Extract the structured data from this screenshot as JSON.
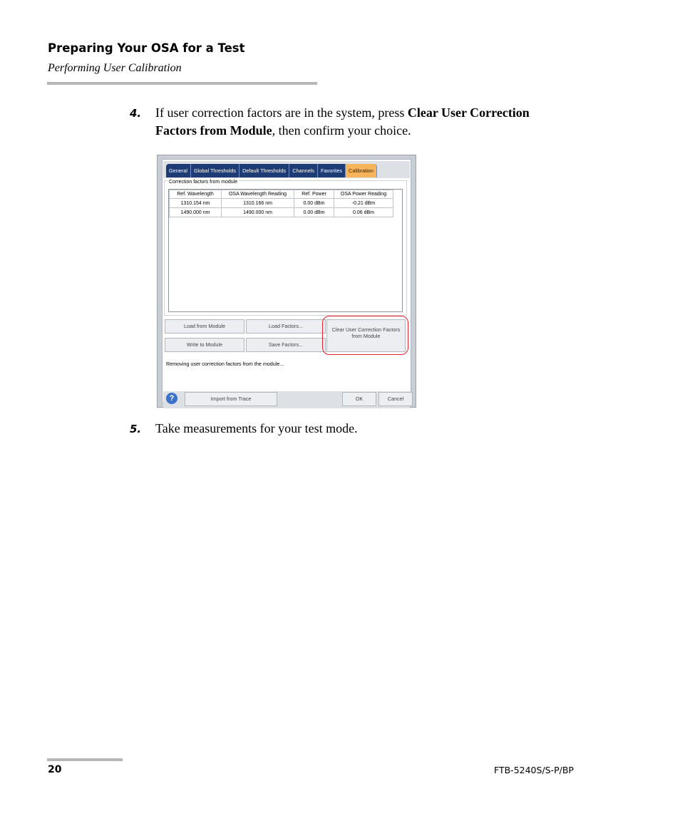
{
  "header": {
    "title": "Preparing Your OSA for a Test",
    "subtitle": "Performing User Calibration"
  },
  "steps": [
    {
      "number": "4.",
      "text_pre": "If user correction factors are in the system, press ",
      "text_bold": "Clear User Correction Factors from Module",
      "text_post": ", then confirm your choice."
    },
    {
      "number": "5.",
      "text": "Take measurements for your test mode."
    }
  ],
  "screenshot": {
    "tabs": [
      "General",
      "Global Thresholds",
      "Default Thresholds",
      "Channels",
      "Favorites",
      "Calibration"
    ],
    "active_tab": "Calibration",
    "group_label": "Correction factors from module",
    "table": {
      "headers": [
        "Ref. Wavelength",
        "OSA Wavelength Reading",
        "Ref. Power",
        "OSA Power Reading"
      ],
      "rows": [
        [
          "1310.154 nm",
          "1310.166 nm",
          "0.00 dBm",
          "-0.21 dBm"
        ],
        [
          "1490.000 nm",
          "1490.000 nm",
          "0.00 dBm",
          "0.06 dBm"
        ]
      ]
    },
    "buttons": {
      "load_from_module": "Load from Module",
      "load_factors": "Load Factors...",
      "write_to_module": "Write to Module",
      "save_factors": "Save Factors...",
      "clear_factors": "Clear User Correction Factors from Module"
    },
    "status": "Removing user correction factors from the module...",
    "footer": {
      "help": "?",
      "import_from_trace": "Import from Trace",
      "ok": "OK",
      "cancel": "Cancel"
    },
    "highlight_color": "#e8202b"
  },
  "footer": {
    "page_number": "20",
    "product": "FTB-5240S/S-P/BP"
  }
}
